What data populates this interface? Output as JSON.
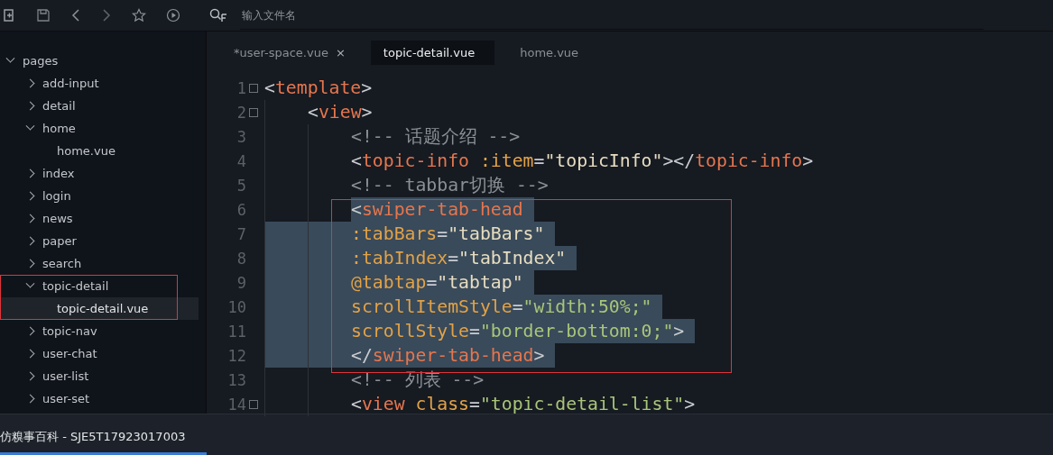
{
  "toolbar": {
    "search": {
      "placeholder": "输入文件名"
    }
  },
  "tree": {
    "label": "pages",
    "expanded": true,
    "children": [
      {
        "label": "add-input",
        "expanded": false,
        "annotated": false
      },
      {
        "label": "detail",
        "expanded": false,
        "annotated": false
      },
      {
        "label": "home",
        "expanded": true,
        "annotated": false,
        "children": [
          {
            "label": "home.vue",
            "selected": false
          }
        ]
      },
      {
        "label": "index",
        "expanded": false,
        "annotated": false
      },
      {
        "label": "login",
        "expanded": false,
        "annotated": false
      },
      {
        "label": "news",
        "expanded": false,
        "annotated": false
      },
      {
        "label": "paper",
        "expanded": false,
        "annotated": false
      },
      {
        "label": "search",
        "expanded": false,
        "annotated": false
      },
      {
        "label": "topic-detail",
        "expanded": true,
        "annotated": true,
        "children": [
          {
            "label": "topic-detail.vue",
            "selected": true
          }
        ]
      },
      {
        "label": "topic-nav",
        "expanded": false,
        "annotated": false
      },
      {
        "label": "user-chat",
        "expanded": false,
        "annotated": false
      },
      {
        "label": "user-list",
        "expanded": false,
        "annotated": false
      },
      {
        "label": "user-set",
        "expanded": false,
        "annotated": false
      }
    ]
  },
  "tabs": [
    {
      "label": "*user-space.vue",
      "selected": false,
      "close": "×"
    },
    {
      "label": "topic-detail.vue",
      "selected": true
    },
    {
      "label": "home.vue",
      "selected": false
    }
  ],
  "code": [
    {
      "number": "1",
      "fold": true,
      "selected": false,
      "annotated": false,
      "tokens": [
        {
          "kind": "punct",
          "text": "<"
        },
        {
          "kind": "tag",
          "text": "template"
        },
        {
          "kind": "punct",
          "text": ">"
        }
      ],
      "children": [
        {
          "number": "2",
          "fold": true,
          "selected": false,
          "annotated": false,
          "tokens": [
            {
              "kind": "punct",
              "text": "<"
            },
            {
              "kind": "tag",
              "text": "view"
            },
            {
              "kind": "punct",
              "text": ">"
            }
          ],
          "children": [
            {
              "number": "3",
              "fold": false,
              "selected": false,
              "annotated": false,
              "tokens": [
                {
                  "kind": "comment",
                  "text": "<!-- 话题介绍 -->"
                }
              ]
            },
            {
              "number": "4",
              "fold": false,
              "selected": false,
              "annotated": false,
              "tokens": [
                {
                  "kind": "punct",
                  "text": "<"
                },
                {
                  "kind": "tag",
                  "text": "topic-info"
                },
                {
                  "kind": "attr",
                  "text": " :item"
                },
                {
                  "kind": "punct",
                  "text": "="
                },
                {
                  "kind": "expr",
                  "text": "\"topicInfo\""
                },
                {
                  "kind": "punct",
                  "text": "></"
                },
                {
                  "kind": "tag",
                  "text": "topic-info"
                },
                {
                  "kind": "punct",
                  "text": ">"
                }
              ]
            },
            {
              "number": "5",
              "fold": false,
              "selected": false,
              "annotated": false,
              "tokens": [
                {
                  "kind": "comment",
                  "text": "<!-- tabbar切换 -->"
                }
              ]
            },
            {
              "number": "6",
              "fold": false,
              "selected": true,
              "annotated": true,
              "tokens": [
                {
                  "kind": "punct",
                  "text": "<"
                },
                {
                  "kind": "tag",
                  "text": "swiper-tab-head"
                }
              ]
            },
            {
              "number": "7",
              "fold": false,
              "selected": true,
              "annotated": true,
              "tokens": [
                {
                  "kind": "attr",
                  "text": ":tabBars"
                },
                {
                  "kind": "punct",
                  "text": "="
                },
                {
                  "kind": "expr",
                  "text": "\"tabBars\""
                }
              ]
            },
            {
              "number": "8",
              "fold": false,
              "selected": true,
              "annotated": true,
              "tokens": [
                {
                  "kind": "attr",
                  "text": ":tabIndex"
                },
                {
                  "kind": "punct",
                  "text": "="
                },
                {
                  "kind": "expr",
                  "text": "\"tabIndex\""
                }
              ]
            },
            {
              "number": "9",
              "fold": false,
              "selected": true,
              "annotated": true,
              "tokens": [
                {
                  "kind": "attr",
                  "text": "@tabtap"
                },
                {
                  "kind": "punct",
                  "text": "="
                },
                {
                  "kind": "expr",
                  "text": "\"tabtap\""
                }
              ]
            },
            {
              "number": "10",
              "fold": false,
              "selected": true,
              "annotated": true,
              "tokens": [
                {
                  "kind": "attr",
                  "text": "scrollItemStyle"
                },
                {
                  "kind": "punct",
                  "text": "="
                },
                {
                  "kind": "str",
                  "text": "\"width:50%;\""
                }
              ]
            },
            {
              "number": "11",
              "fold": false,
              "selected": true,
              "annotated": true,
              "tokens": [
                {
                  "kind": "attr",
                  "text": "scrollStyle"
                },
                {
                  "kind": "punct",
                  "text": "="
                },
                {
                  "kind": "str",
                  "text": "\"border-bottom:0;\""
                },
                {
                  "kind": "punct",
                  "text": ">"
                }
              ]
            },
            {
              "number": "12",
              "fold": false,
              "selected": true,
              "annotated": true,
              "tokens": [
                {
                  "kind": "punct",
                  "text": "</"
                },
                {
                  "kind": "tag",
                  "text": "swiper-tab-head"
                },
                {
                  "kind": "punct",
                  "text": ">"
                }
              ]
            },
            {
              "number": "13",
              "fold": false,
              "selected": false,
              "annotated": false,
              "tokens": [
                {
                  "kind": "comment",
                  "text": "<!-- 列表 -->"
                }
              ]
            },
            {
              "number": "14",
              "fold": true,
              "selected": false,
              "annotated": false,
              "tokens": [
                {
                  "kind": "punct",
                  "text": "<"
                },
                {
                  "kind": "tag",
                  "text": "view"
                },
                {
                  "kind": "attr",
                  "text": " class"
                },
                {
                  "kind": "punct",
                  "text": "="
                },
                {
                  "kind": "str",
                  "text": "\"topic-detail-list\""
                },
                {
                  "kind": "punct",
                  "text": ">"
                }
              ]
            }
          ]
        }
      ]
    }
  ],
  "taskbar": {
    "title": "仿糗事百科 - SJE5T17923017003",
    "active": true
  }
}
